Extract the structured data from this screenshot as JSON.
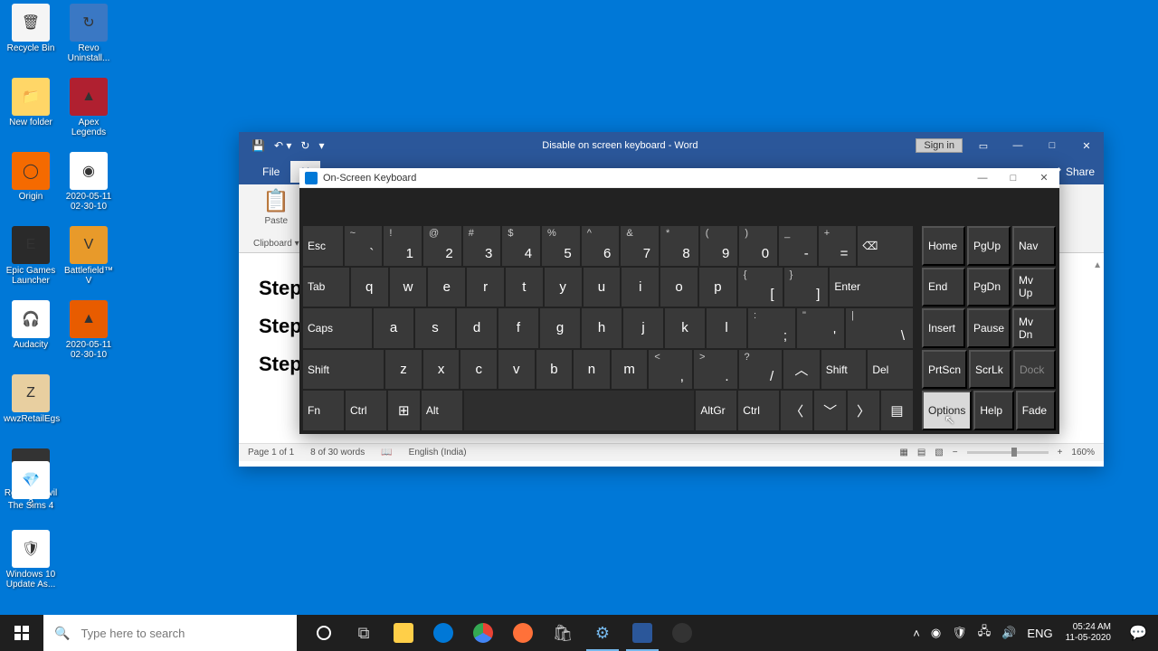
{
  "desktop": {
    "icons": [
      {
        "label": "Recycle Bin",
        "bg": "#f5f5f5",
        "char": "🗑"
      },
      {
        "label": "New folder",
        "bg": "#ffd667",
        "char": "📁"
      },
      {
        "label": "Origin",
        "bg": "#f56a00",
        "char": "◯"
      },
      {
        "label": "Epic Games Launcher",
        "bg": "#2a2a2a",
        "char": "E"
      },
      {
        "label": "Audacity",
        "bg": "#fff",
        "char": "🎧"
      },
      {
        "label": "wwzRetailEgs",
        "bg": "#e8cfa0",
        "char": "Z"
      },
      {
        "label": "Resident Evil 2",
        "bg": "#333",
        "char": "RE"
      },
      {
        "label": "Revo Uninstall...",
        "bg": "#3a78c4",
        "char": "↻"
      },
      {
        "label": "Apex Legends",
        "bg": "#b02030",
        "char": "▲"
      },
      {
        "label": "2020-05-11 02-30-10",
        "bg": "#fff",
        "char": "◉"
      },
      {
        "label": "Battlefield™ V",
        "bg": "#e89a2a",
        "char": "V"
      },
      {
        "label": "2020-05-11 02-30-10",
        "bg": "#e85c00",
        "char": "▲"
      },
      {
        "label": "The Sims 4",
        "bg": "#fff",
        "char": "💎"
      },
      {
        "label": "Windows 10 Update As...",
        "bg": "#fff",
        "char": "🛡"
      }
    ]
  },
  "word": {
    "title": "Disable on screen keyboard  -  Word",
    "sign_in": "Sign in",
    "file_tab": "File",
    "home_tab": "H",
    "share": "Share",
    "paste": "Paste",
    "clipboard": "Clipboard",
    "lines": [
      "Step",
      "Step",
      "Step"
    ],
    "status": {
      "page": "Page 1 of 1",
      "words": "8 of 30 words",
      "lang": "English (India)",
      "zoom": "160%"
    }
  },
  "osk": {
    "title": "On-Screen Keyboard",
    "row1": [
      {
        "t": "Esc",
        "type": "label"
      },
      {
        "t": "~",
        "b": "`"
      },
      {
        "t": "!",
        "b": "1"
      },
      {
        "t": "@",
        "b": "2"
      },
      {
        "t": "#",
        "b": "3"
      },
      {
        "t": "$",
        "b": "4"
      },
      {
        "t": "%",
        "b": "5"
      },
      {
        "t": "^",
        "b": "6"
      },
      {
        "t": "&",
        "b": "7"
      },
      {
        "t": "*",
        "b": "8"
      },
      {
        "t": "(",
        "b": "9"
      },
      {
        "t": ")",
        "b": "0"
      },
      {
        "t": "_",
        "b": "-"
      },
      {
        "t": "+",
        "b": "="
      },
      {
        "t": "⌫",
        "type": "label",
        "w": "w15"
      }
    ],
    "row2": [
      {
        "t": "Tab",
        "type": "label"
      },
      {
        "c": "q"
      },
      {
        "c": "w"
      },
      {
        "c": "e"
      },
      {
        "c": "r"
      },
      {
        "c": "t"
      },
      {
        "c": "y"
      },
      {
        "c": "u"
      },
      {
        "c": "i"
      },
      {
        "c": "o"
      },
      {
        "c": "p"
      },
      {
        "t": "{",
        "b": "["
      },
      {
        "t": "}",
        "b": "]"
      },
      {
        "t": "Enter",
        "type": "label",
        "w": "w2"
      }
    ],
    "row3": [
      {
        "t": "Caps",
        "type": "label",
        "w": "w15"
      },
      {
        "c": "a"
      },
      {
        "c": "s"
      },
      {
        "c": "d"
      },
      {
        "c": "f"
      },
      {
        "c": "g"
      },
      {
        "c": "h"
      },
      {
        "c": "j"
      },
      {
        "c": "k"
      },
      {
        "c": "l"
      },
      {
        "t": ":",
        "b": ";"
      },
      {
        "t": "\"",
        "b": "'"
      },
      {
        "t": "|",
        "b": "\\",
        "w": "w15"
      }
    ],
    "row4": [
      {
        "t": "Shift",
        "type": "label",
        "w": "w2"
      },
      {
        "c": "z"
      },
      {
        "c": "x"
      },
      {
        "c": "c"
      },
      {
        "c": "v"
      },
      {
        "c": "b"
      },
      {
        "c": "n"
      },
      {
        "c": "m"
      },
      {
        "t": "<",
        "b": ","
      },
      {
        "t": ">",
        "b": "."
      },
      {
        "t": "?",
        "b": "/"
      },
      {
        "c": "︿",
        "type": "single"
      },
      {
        "t": "Shift",
        "type": "label"
      },
      {
        "t": "Del",
        "type": "label"
      }
    ],
    "row5": [
      {
        "t": "Fn",
        "type": "label"
      },
      {
        "t": "Ctrl",
        "type": "label"
      },
      {
        "c": "⊞",
        "type": "single"
      },
      {
        "t": "Alt",
        "type": "label"
      },
      {
        "t": "",
        "type": "spacer"
      },
      {
        "t": "AltGr",
        "type": "label"
      },
      {
        "t": "Ctrl",
        "type": "label"
      },
      {
        "c": "〈",
        "type": "single"
      },
      {
        "c": "﹀",
        "type": "single"
      },
      {
        "c": "〉",
        "type": "single"
      },
      {
        "c": "▤",
        "type": "single"
      }
    ],
    "side": [
      [
        "Home",
        "PgUp",
        "Nav"
      ],
      [
        "End",
        "PgDn",
        "Mv Up"
      ],
      [
        "Insert",
        "Pause",
        "Mv Dn"
      ],
      [
        "PrtScn",
        "ScrLk",
        "Dock"
      ],
      [
        "Options",
        "Help",
        "Fade"
      ]
    ]
  },
  "taskbar": {
    "search_placeholder": "Type here to search",
    "lang": "ENG",
    "time": "05:24 AM",
    "date": "11-05-2020"
  }
}
